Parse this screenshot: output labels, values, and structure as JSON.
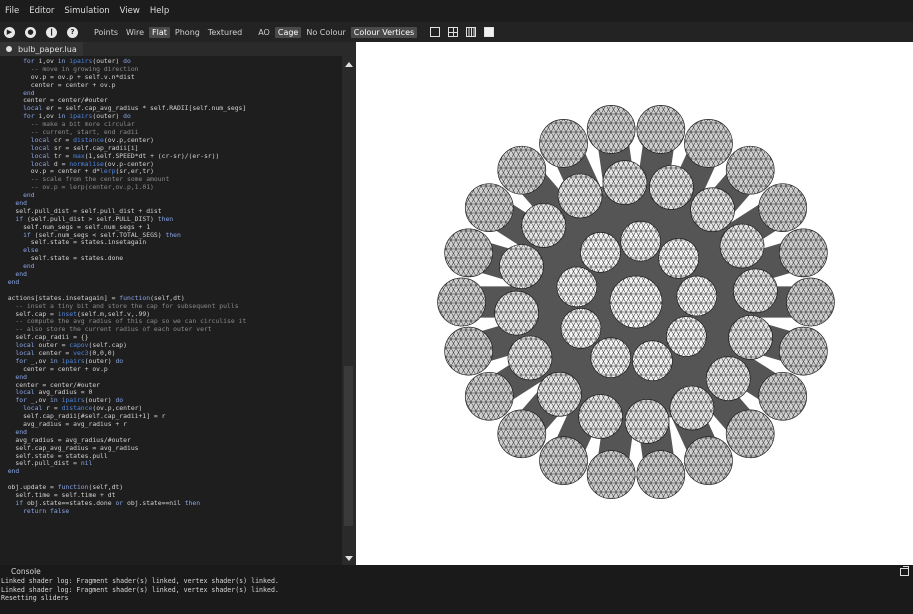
{
  "menu": [
    "File",
    "Editor",
    "Simulation",
    "View",
    "Help"
  ],
  "toolbar": {
    "buttons": [
      {
        "name": "play-button",
        "glyph": "▶"
      },
      {
        "name": "record-button",
        "glyph": "●"
      },
      {
        "name": "pause-button",
        "glyph": "❙"
      },
      {
        "name": "help-button",
        "glyph": "?"
      }
    ],
    "render_modes": [
      "Points",
      "Wire",
      "Flat",
      "Phong",
      "Textured"
    ],
    "active_render_mode": "Flat",
    "ao": "AO",
    "cage": "Cage",
    "colour_modes": [
      "No Colour",
      "Colour Vertices"
    ],
    "active_colour_mode": "Colour Vertices",
    "view_layouts": [
      "single-view-icon",
      "quad-view-icon",
      "grid-view-icon",
      "filled-view-icon"
    ]
  },
  "tab": {
    "label": "bulb_paper.lua",
    "icon": "file-dot-icon"
  },
  "code": [
    [
      [
        "kw",
        "      for "
      ],
      [
        "t",
        "i,ov "
      ],
      [
        "kw",
        "in "
      ],
      [
        "fn",
        "ipairs"
      ],
      [
        "t",
        "(outer) "
      ],
      [
        "kw",
        "do"
      ]
    ],
    [
      [
        "cm",
        "        -- move in growing direction"
      ]
    ],
    [
      [
        "t",
        "        ov.p = ov.p + self.v.n*dist"
      ]
    ],
    [
      [
        "t",
        "        center = center + ov.p"
      ]
    ],
    [
      [
        "kw",
        "      end"
      ]
    ],
    [
      [
        "t",
        "      center = center/#outer"
      ]
    ],
    [
      [
        "kw",
        "      local "
      ],
      [
        "t",
        "er = self.cap_avg_radius * self.RADII[self.num_segs]"
      ]
    ],
    [
      [
        "kw",
        "      for "
      ],
      [
        "t",
        "i,ov "
      ],
      [
        "kw",
        "in "
      ],
      [
        "fn",
        "ipairs"
      ],
      [
        "t",
        "(outer) "
      ],
      [
        "kw",
        "do"
      ]
    ],
    [
      [
        "cm",
        "        -- make a bit more circular"
      ]
    ],
    [
      [
        "cm",
        "        -- current, start, end radii"
      ]
    ],
    [
      [
        "kw",
        "        local "
      ],
      [
        "t",
        "cr = "
      ],
      [
        "fn",
        "distance"
      ],
      [
        "t",
        "(ov.p,center)"
      ]
    ],
    [
      [
        "kw",
        "        local "
      ],
      [
        "t",
        "sr = self.cap_radii[i]"
      ]
    ],
    [
      [
        "kw",
        "        local "
      ],
      [
        "t",
        "tr = "
      ],
      [
        "fn",
        "max"
      ],
      [
        "t",
        "(1,self.SPEED*dt + (cr-sr)/(er-sr))"
      ]
    ],
    [
      [
        "kw",
        "        local "
      ],
      [
        "t",
        "d = "
      ],
      [
        "fn",
        "normalise"
      ],
      [
        "t",
        "(ov.p-center)"
      ]
    ],
    [
      [
        "t",
        "        ov.p = center + d*"
      ],
      [
        "fn",
        "lerp"
      ],
      [
        "t",
        "(sr,er,tr)"
      ]
    ],
    [
      [
        "cm",
        "        -- scale from the center some amount"
      ]
    ],
    [
      [
        "cm",
        "        -- ov.p = lerp(center,ov.p,1.01)"
      ]
    ],
    [
      [
        "kw",
        "      end"
      ]
    ],
    [
      [
        "kw",
        "    end"
      ]
    ],
    [
      [
        "t",
        "    self.pull_dist = self.pull_dist + dist"
      ]
    ],
    [
      [
        "kw",
        "    if "
      ],
      [
        "t",
        "(self.pull_dist > self.PULL_DIST) "
      ],
      [
        "kw",
        "then"
      ]
    ],
    [
      [
        "t",
        "      self.num_segs = self.num_segs + 1"
      ]
    ],
    [
      [
        "kw",
        "      if "
      ],
      [
        "t",
        "(self.num_segs < self.TOTAL_SEGS) "
      ],
      [
        "kw",
        "then"
      ]
    ],
    [
      [
        "t",
        "        self.state = states.insetagain"
      ]
    ],
    [
      [
        "kw",
        "      else"
      ]
    ],
    [
      [
        "t",
        "        self.state = states.done"
      ]
    ],
    [
      [
        "kw",
        "      end"
      ]
    ],
    [
      [
        "kw",
        "    end"
      ]
    ],
    [
      [
        "kw",
        "  end"
      ]
    ],
    [
      [
        "t",
        ""
      ]
    ],
    [
      [
        "t",
        "  actions[states.insetagain] = "
      ],
      [
        "kw",
        "function"
      ],
      [
        "t",
        "(self,dt)"
      ]
    ],
    [
      [
        "cm",
        "    -- inset a tiny bit and store the cap for subsequent pulls"
      ]
    ],
    [
      [
        "t",
        "    self.cap = "
      ],
      [
        "fn",
        "inset"
      ],
      [
        "t",
        "(self.m,self.v,.99)"
      ]
    ],
    [
      [
        "cm",
        "    -- compute the avg radius of this cap so we can circulise it"
      ]
    ],
    [
      [
        "cm",
        "    -- also store the current radius of each outer vert"
      ]
    ],
    [
      [
        "t",
        "    self.cap_radii = {}"
      ]
    ],
    [
      [
        "kw",
        "    local "
      ],
      [
        "t",
        "outer = "
      ],
      [
        "fn",
        "capov"
      ],
      [
        "t",
        "(self.cap)"
      ]
    ],
    [
      [
        "kw",
        "    local "
      ],
      [
        "t",
        "center = "
      ],
      [
        "fn",
        "vec3"
      ],
      [
        "t",
        "(0,0,0)"
      ]
    ],
    [
      [
        "kw",
        "    for "
      ],
      [
        "t",
        "_,ov "
      ],
      [
        "kw",
        "in "
      ],
      [
        "fn",
        "ipairs"
      ],
      [
        "t",
        "(outer) "
      ],
      [
        "kw",
        "do"
      ]
    ],
    [
      [
        "t",
        "      center = center + ov.p"
      ]
    ],
    [
      [
        "kw",
        "    end"
      ]
    ],
    [
      [
        "t",
        "    center = center/#outer"
      ]
    ],
    [
      [
        "kw",
        "    local "
      ],
      [
        "t",
        "avg_radius = 0"
      ]
    ],
    [
      [
        "kw",
        "    for "
      ],
      [
        "t",
        "_,ov "
      ],
      [
        "kw",
        "in "
      ],
      [
        "fn",
        "ipairs"
      ],
      [
        "t",
        "(outer) "
      ],
      [
        "kw",
        "do"
      ]
    ],
    [
      [
        "kw",
        "      local "
      ],
      [
        "t",
        "r = "
      ],
      [
        "fn",
        "distance"
      ],
      [
        "t",
        "(ov.p,center)"
      ]
    ],
    [
      [
        "t",
        "      self.cap_radii[#self.cap_radii+1] = r"
      ]
    ],
    [
      [
        "t",
        "      avg_radius = avg_radius + r"
      ]
    ],
    [
      [
        "kw",
        "    end"
      ]
    ],
    [
      [
        "t",
        "    avg_radius = avg_radius/#outer"
      ]
    ],
    [
      [
        "t",
        "    self.cap_avg_radius = avg_radius"
      ]
    ],
    [
      [
        "t",
        "    self.state = states.pull"
      ]
    ],
    [
      [
        "t",
        "    self.pull_dist = "
      ],
      [
        "kw",
        "nil"
      ]
    ],
    [
      [
        "kw",
        "  end"
      ]
    ],
    [
      [
        "t",
        ""
      ]
    ],
    [
      [
        "t",
        "  obj.update = "
      ],
      [
        "kw",
        "function"
      ],
      [
        "t",
        "(self,dt)"
      ]
    ],
    [
      [
        "t",
        "    self.time = self.time + dt"
      ]
    ],
    [
      [
        "kw",
        "    if "
      ],
      [
        "t",
        "obj.state==states.done "
      ],
      [
        "kw",
        "or "
      ],
      [
        "t",
        "obj.state==nil "
      ],
      [
        "kw",
        "then"
      ]
    ],
    [
      [
        "kw",
        "      return false"
      ]
    ]
  ],
  "console": {
    "title": "Console",
    "lines": [
      "Linked shader log: Fragment shader(s) linked, vertex shader(s) linked.",
      "Linked shader log: Fragment shader(s) linked, vertex shader(s) linked.",
      "Resetting sliders"
    ]
  }
}
